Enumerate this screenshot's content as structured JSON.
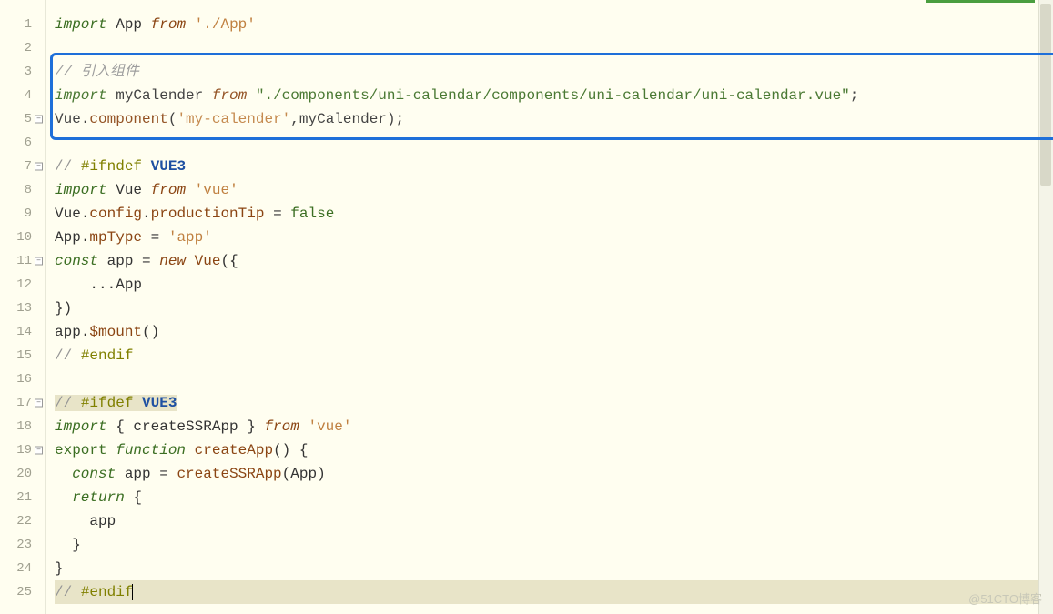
{
  "lines": [
    {
      "num": "1",
      "fold": false
    },
    {
      "num": "2",
      "fold": false
    },
    {
      "num": "3",
      "fold": false
    },
    {
      "num": "4",
      "fold": false
    },
    {
      "num": "5",
      "fold": true
    },
    {
      "num": "6",
      "fold": false
    },
    {
      "num": "7",
      "fold": true
    },
    {
      "num": "8",
      "fold": false
    },
    {
      "num": "9",
      "fold": false
    },
    {
      "num": "10",
      "fold": false
    },
    {
      "num": "11",
      "fold": true
    },
    {
      "num": "12",
      "fold": false
    },
    {
      "num": "13",
      "fold": false
    },
    {
      "num": "14",
      "fold": false
    },
    {
      "num": "15",
      "fold": false
    },
    {
      "num": "16",
      "fold": false
    },
    {
      "num": "17",
      "fold": true
    },
    {
      "num": "18",
      "fold": false
    },
    {
      "num": "19",
      "fold": true
    },
    {
      "num": "20",
      "fold": false
    },
    {
      "num": "21",
      "fold": false
    },
    {
      "num": "22",
      "fold": false
    },
    {
      "num": "23",
      "fold": false
    },
    {
      "num": "24",
      "fold": false
    },
    {
      "num": "25",
      "fold": false
    }
  ],
  "fold_symbol": "−",
  "code": {
    "l1": {
      "kw_import": "import",
      "ident": "App",
      "kw_from": "from",
      "str": "'./App'"
    },
    "l3": {
      "comment": "// 引入组件"
    },
    "l4": {
      "kw_import": "import",
      "ident": "myCalender",
      "kw_from": "from",
      "str": "\"./components/uni-calendar/components/uni-calendar/uni-calendar.vue\"",
      "semi": ";"
    },
    "l5": {
      "obj": "Vue",
      "dot": ".",
      "method": "component",
      "open": "(",
      "str": "'my-calender'",
      "comma": ",",
      "arg": "myCalender",
      "close": ")",
      "semi": ";"
    },
    "l7": {
      "pragma_pre": "// ",
      "pragma_key": "#ifndef",
      "sp": " ",
      "pragma_val": "VUE3"
    },
    "l8": {
      "kw_import": "import",
      "ident": "Vue",
      "kw_from": "from",
      "str": "'vue'"
    },
    "l9": {
      "obj": "Vue",
      "d1": ".",
      "p1": "config",
      "d2": ".",
      "p2": "productionTip",
      "eq": " = ",
      "val": "false"
    },
    "l10": {
      "obj": "App",
      "d1": ".",
      "p1": "mpType",
      "eq": " = ",
      "val": "'app'"
    },
    "l11": {
      "kw_const": "const",
      "ident": "app",
      "eq": " = ",
      "kw_new": "new",
      "sp": " ",
      "cls": "Vue",
      "open": "({"
    },
    "l12": {
      "indent": "    ",
      "spread": "...",
      "ident": "App"
    },
    "l13": {
      "close": "})"
    },
    "l14": {
      "obj": "app",
      "d1": ".",
      "method": "$mount",
      "paren": "()"
    },
    "l15": {
      "pragma_pre": "// ",
      "pragma_key": "#endif"
    },
    "l17": {
      "pragma_pre": "// ",
      "pragma_key": "#ifdef",
      "sp": " ",
      "pragma_val": "VUE3"
    },
    "l18": {
      "kw_import": "import",
      "open": " { ",
      "ident": "createSSRApp",
      "close": " } ",
      "kw_from": "from",
      "str": "'vue'"
    },
    "l19": {
      "kw_export": "export",
      "sp": " ",
      "kw_function": "function",
      "sp2": " ",
      "fname": "createApp",
      "paren": "()",
      "brace": " {"
    },
    "l20": {
      "indent": "  ",
      "kw_const": "const",
      "ident": " app ",
      "eq": "= ",
      "fn": "createSSRApp",
      "open": "(",
      "arg": "App",
      "close": ")"
    },
    "l21": {
      "indent": "  ",
      "kw_return": "return",
      "brace": " {"
    },
    "l22": {
      "indent": "    ",
      "ident": "app"
    },
    "l23": {
      "indent": "  ",
      "brace": "}"
    },
    "l24": {
      "brace": "}"
    },
    "l25": {
      "pragma_pre": "// ",
      "pragma_key": "#endif"
    }
  },
  "watermark": "@51CTO博客"
}
